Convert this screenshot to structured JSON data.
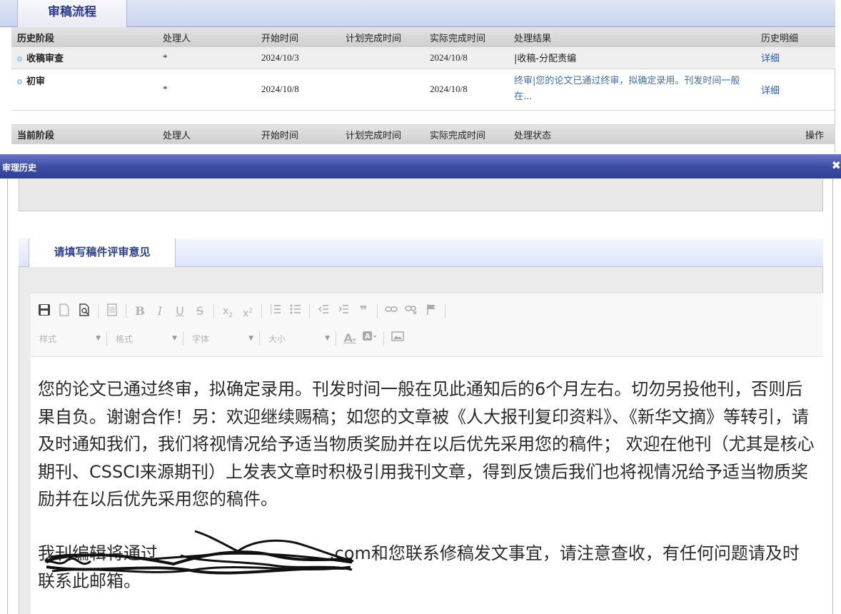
{
  "review": {
    "tab_label": "审稿流程",
    "history_headers": [
      "历史阶段",
      "处理人",
      "开始时间",
      "计划完成时间",
      "实际完成时间",
      "处理结果",
      "历史明细"
    ],
    "history_rows": [
      {
        "stage": "收稿审查",
        "handler": "*",
        "start": "2024/10/3",
        "planned": "",
        "actual": "2024/10/8",
        "result": "|收稿-分配责编",
        "detail": "详细"
      },
      {
        "stage": "初审",
        "handler": "*",
        "start": "2024/10/8",
        "planned": "",
        "actual": "2024/10/8",
        "result": "终审|您的论文已通过终审，拟确定录用。刊发时间一般在...",
        "detail": "详细"
      }
    ],
    "current_headers": [
      "当前阶段",
      "处理人",
      "开始时间",
      "计划完成时间",
      "实际完成时间",
      "处理状态",
      "操作"
    ]
  },
  "modal": {
    "title": "审理历史",
    "close_glyph": "✖",
    "comment_tab": "请填写稿件评审意见",
    "toolbar": {
      "format_combos": [
        "样式",
        "格式",
        "字体",
        "大小"
      ]
    },
    "content": {
      "para1": "您的论文已通过终审，拟确定录用。刊发时间一般在见此通知后的6个月左右。切勿另投他刊，否则后果自负。谢谢合作！另：欢迎继续赐稿；如您的文章被《人大报刊复印资料》、《新华文摘》等转引，请及时通知我们，我们将视情况给予适当物质奖励并在以后优先采用您的稿件； 欢迎在他刊（尤其是核心期刊、CSSCI来源期刊）上发表文章时积极引用我刊文章，得到反馈后我们也将视情况给予适当物质奖励并在以后优先采用您的稿件。",
      "para2_obscured": "我刊编辑将通过",
      "para2_visible": ".com和您联系修稿发文事宜，请注意查收，有任何问题请及时联系此邮箱。"
    }
  },
  "colors": {
    "titlebar": "#3e4ea5",
    "link": "#2a52be",
    "result_blue": "#3e6fb0",
    "tab_text": "#2b3a8c"
  },
  "icons": [
    "save-icon",
    "new-doc-icon",
    "preview-icon",
    "template-icon",
    "bold-icon",
    "italic-icon",
    "underline-icon",
    "strike-icon",
    "subscript-icon",
    "superscript-icon",
    "numbered-list-icon",
    "bulleted-list-icon",
    "outdent-icon",
    "indent-icon",
    "blockquote-icon",
    "link-icon",
    "unlink-icon",
    "anchor-icon",
    "text-color-icon",
    "bg-color-icon",
    "image-icon"
  ]
}
